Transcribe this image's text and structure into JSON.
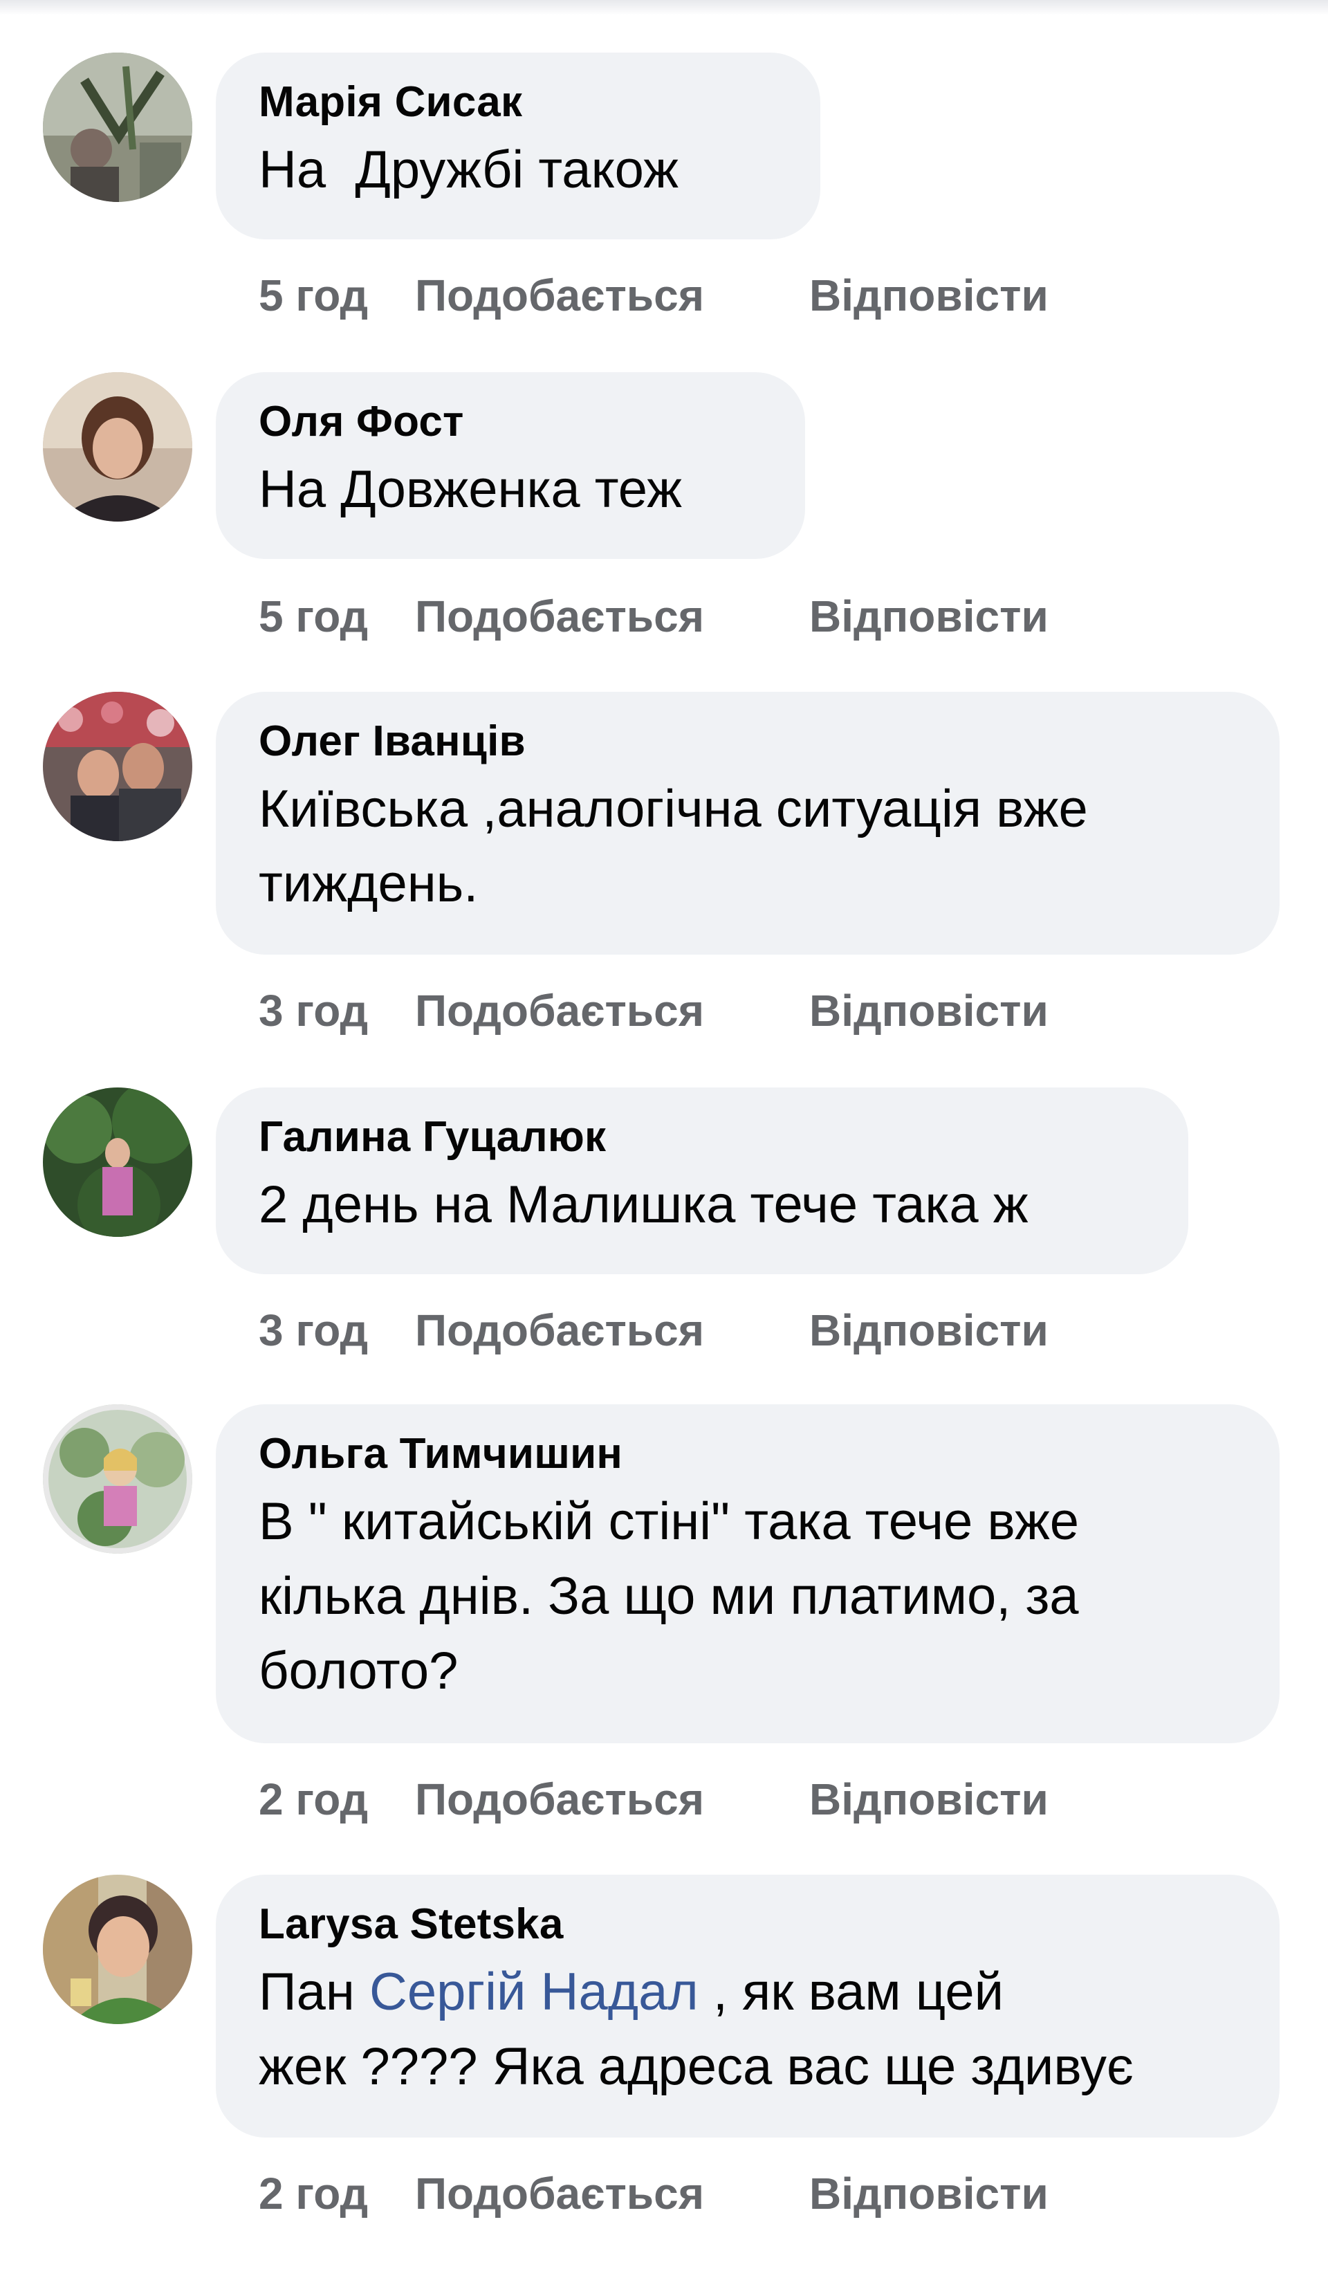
{
  "comments": [
    {
      "author": "Марія Сисак",
      "text": "На  Дружбі також",
      "time": "5 год",
      "like": "Подобається",
      "reply": "Відповісти"
    },
    {
      "author": "Оля Фост",
      "text": "На Довженка теж",
      "time": "5 год",
      "like": "Подобається",
      "reply": "Відповісти"
    },
    {
      "author": "Олег Іванців",
      "text_line1": "Київська ,аналогічна ситуація вже",
      "text_line2": "тиждень.",
      "time": "3 год",
      "like": "Подобається",
      "reply": "Відповісти"
    },
    {
      "author": "Галина Гуцалюк",
      "text": "2 день на Малишка тече така ж",
      "time": "3 год",
      "like": "Подобається",
      "reply": "Відповісти"
    },
    {
      "author": "Ольга Тимчишин",
      "text_line1": "В \" китайській стіні\" така тече вже",
      "text_line2": "кілька днів. За що ми платимо, за",
      "text_line3": "болото?",
      "time": "2 год",
      "like": "Подобається",
      "reply": "Відповісти"
    },
    {
      "author": "Larysa Stetska",
      "text_prefix": "Пан ",
      "mention": "Сергій Надал",
      "text_suffix": " , як вам цей",
      "text_line2": "жек ???? Яка адреса вас ще здивує",
      "time": "2 год",
      "like": "Подобається",
      "reply": "Відповісти"
    }
  ],
  "colors": {
    "bubble": "#f0f2f5",
    "text": "#050505",
    "meta": "#65676b",
    "mention": "#385898"
  }
}
